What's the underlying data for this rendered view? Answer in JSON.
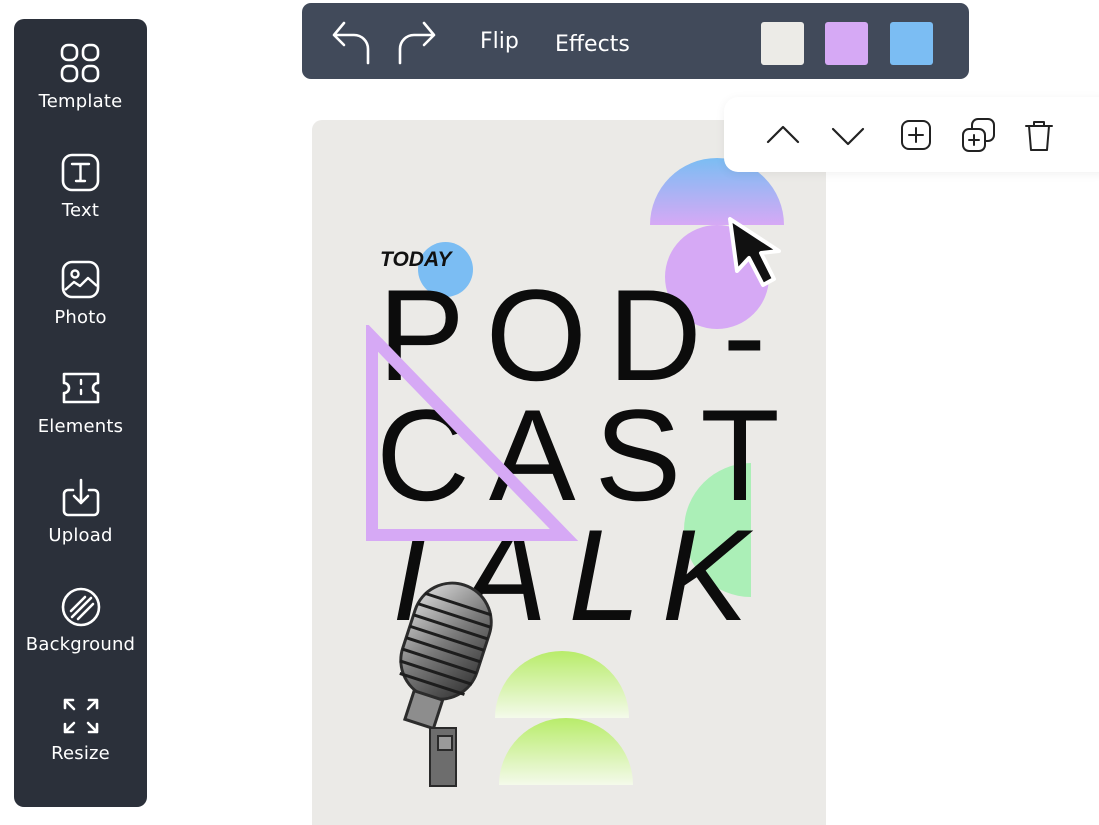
{
  "sidebar": {
    "items": [
      {
        "label": "Template",
        "icon": "template-grid-icon"
      },
      {
        "label": "Text",
        "icon": "text-icon"
      },
      {
        "label": "Photo",
        "icon": "photo-icon"
      },
      {
        "label": "Elements",
        "icon": "elements-icon"
      },
      {
        "label": "Upload",
        "icon": "upload-icon"
      },
      {
        "label": "Background",
        "icon": "background-icon"
      },
      {
        "label": "Resize",
        "icon": "resize-icon"
      }
    ]
  },
  "toolbar": {
    "undo_icon": "undo-icon",
    "redo_icon": "redo-icon",
    "flip_label": "Flip",
    "effects_label": "Effects",
    "swatches": [
      "#ecebe7",
      "#d6a9f5",
      "#7bbdf3"
    ]
  },
  "object_toolbar": {
    "icons": [
      "chevron-up-icon",
      "chevron-down-icon",
      "add-icon",
      "duplicate-icon",
      "trash-icon"
    ]
  },
  "poster": {
    "today": "TODAY",
    "line1": "POD-",
    "line2": "CAST",
    "line3": "TALK",
    "colors": {
      "background": "#ebeae7",
      "blue": "#7bbdf3",
      "purple": "#d6a9f5",
      "green": "#abefb7",
      "lime": "#b8ec6a"
    }
  }
}
